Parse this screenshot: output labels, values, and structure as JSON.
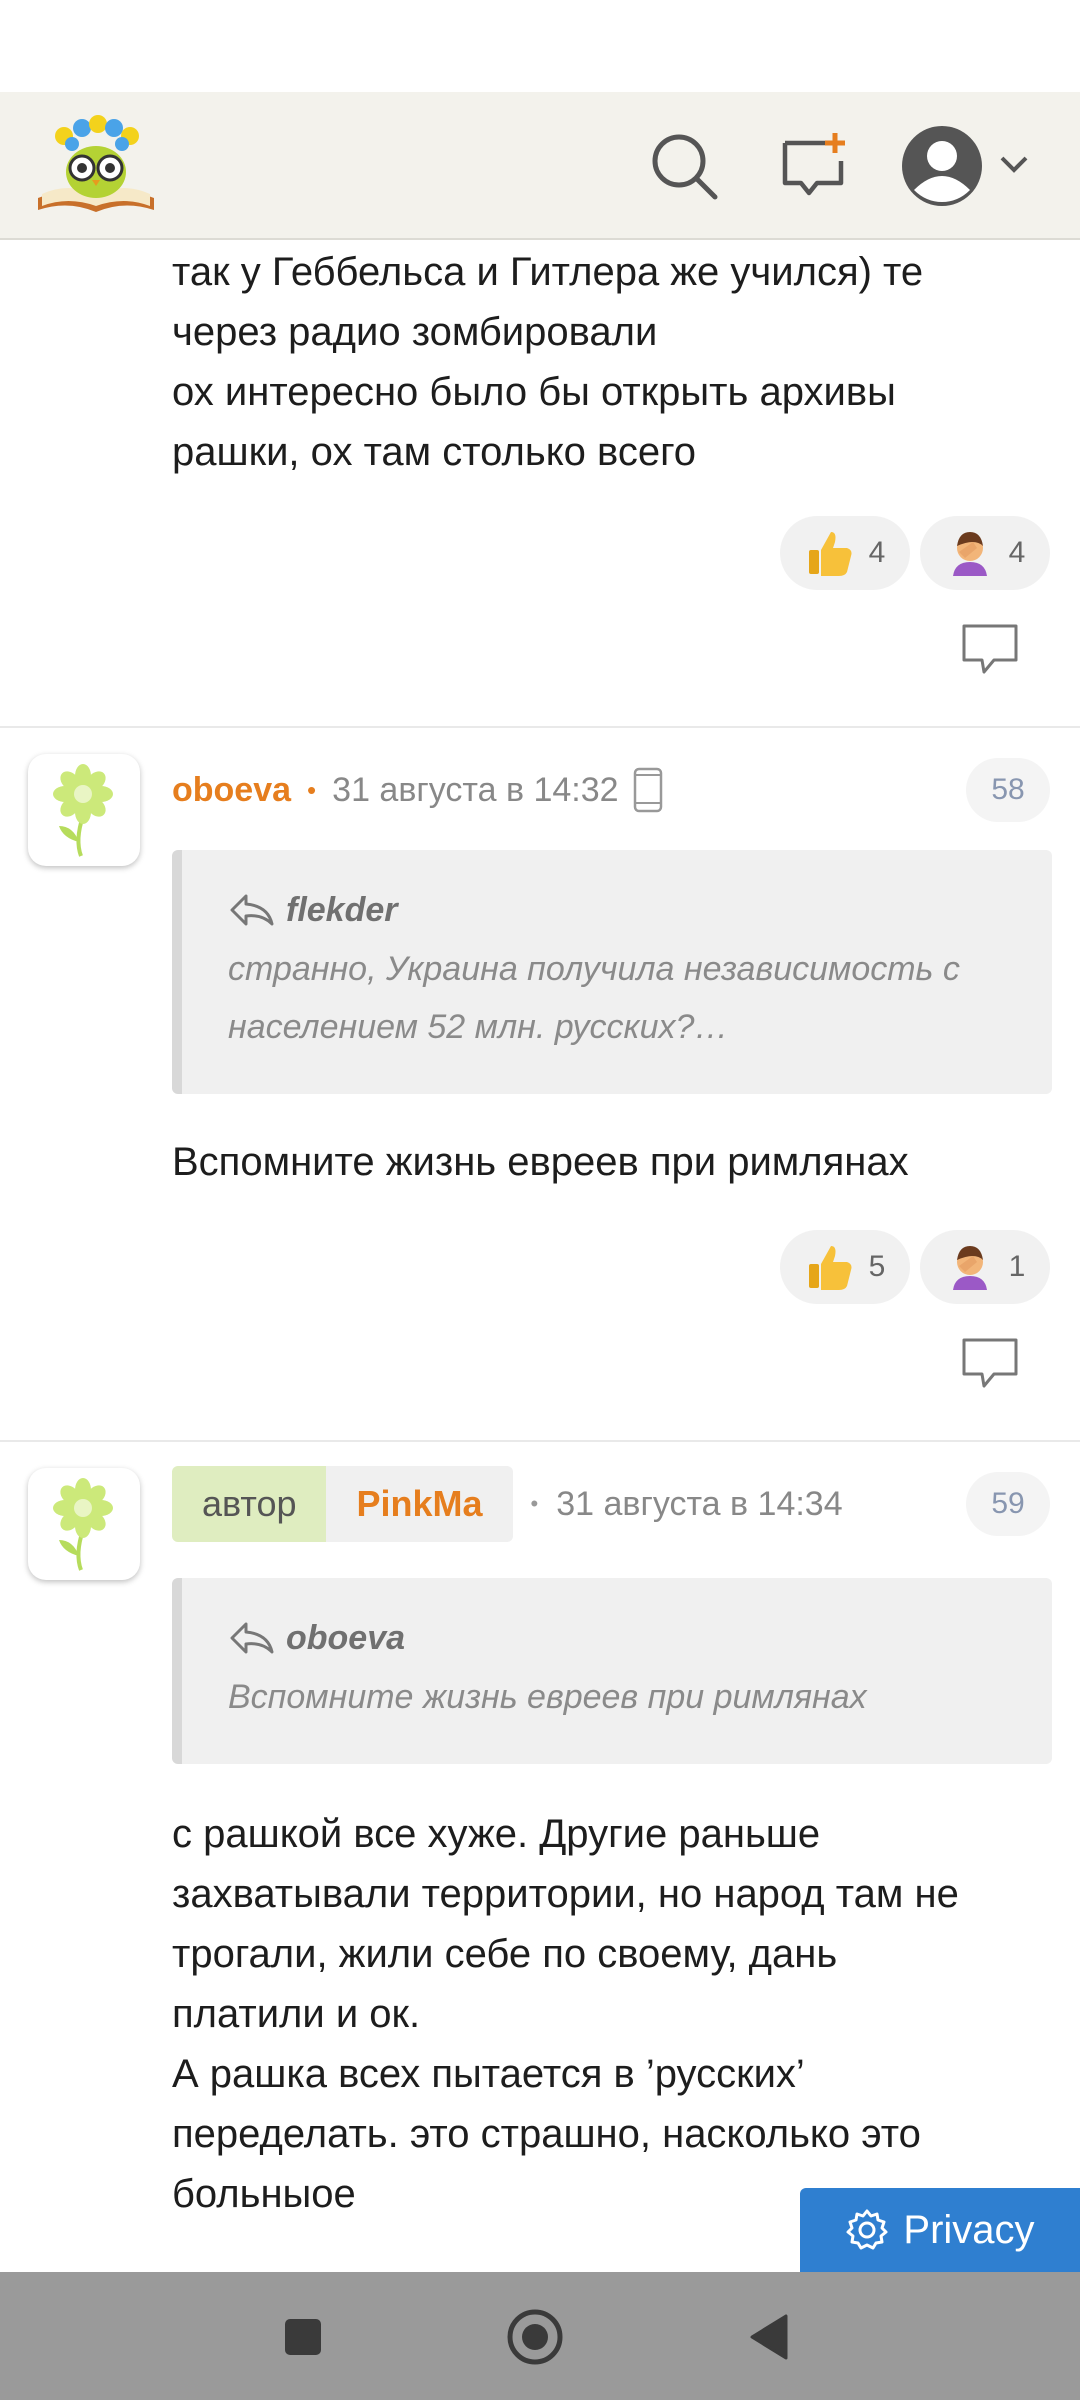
{
  "header": {
    "logo": "owl-with-flowers-on-book-logo",
    "icons": [
      "search-icon",
      "new-message-icon",
      "user-avatar-icon",
      "chevron-down-icon"
    ]
  },
  "comment_tail": {
    "text": "так у Геббельса и Гитлера же учился) те\nчерез радио зомбировали\nох интересно было бы открыть архивы\nрашки, ох там столько всего",
    "reactions": [
      {
        "icon": "thumbs-up-icon",
        "count": "4"
      },
      {
        "icon": "facepalm-icon",
        "count": "4"
      }
    ]
  },
  "comment58": {
    "username": "oboeva",
    "date": "31 августа в 14:32",
    "number": "58",
    "quote_author": "flekder",
    "quote_text": "странно, Украина получила независимость с населением 52 млн. русских?…",
    "text": "Вспомните жизнь евреев при римлянах",
    "reactions": [
      {
        "icon": "thumbs-up-icon",
        "count": "5"
      },
      {
        "icon": "facepalm-icon",
        "count": "1"
      }
    ]
  },
  "comment59": {
    "author_label": "автор",
    "username": "PinkMa",
    "date": "31 августа в 14:34",
    "number": "59",
    "quote_author": "oboeva",
    "quote_text": "Вспомните жизнь евреев при римлянах",
    "text": "с рашкой все хуже. Другие раньше\nзахватывали территории, но народ там не\nтрогали, жили себе по своему, дань\nплатили и ок.\nА рашка всех пытается в ’русских’\nпеределать. это страшно, насколько это\nбольныое"
  },
  "privacy": {
    "label": "Privacy"
  },
  "colors": {
    "accent_orange": "#e67e1e",
    "privacy_blue": "#2f7fd0",
    "author_badge_green": "#dfedc0",
    "header_bg": "#f3f2ec"
  }
}
